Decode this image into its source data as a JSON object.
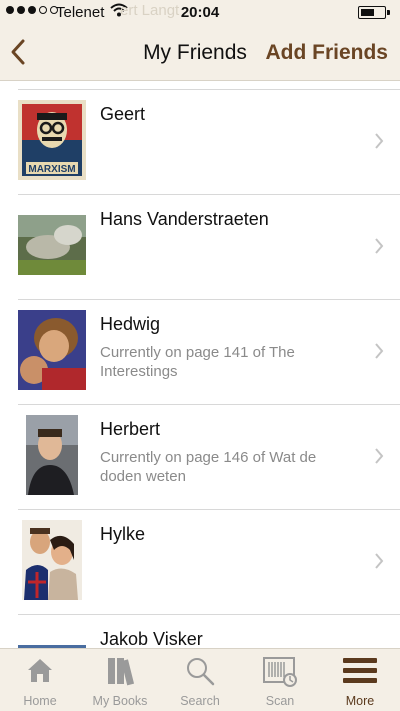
{
  "status_bar": {
    "carrier": "Telenet",
    "time": "20:04"
  },
  "nav": {
    "ghost_title": "ert Langt",
    "title": "My Friends",
    "add_friends": "Add Friends"
  },
  "friends": [
    {
      "name": "Geert",
      "status": "",
      "avatar": "marxism-poster"
    },
    {
      "name": "Hans Vanderstraeten",
      "status": "",
      "avatar": "landscape-photo"
    },
    {
      "name": "Hedwig",
      "status": "Currently on page 141 of The Interestings",
      "avatar": "couple-photo"
    },
    {
      "name": "Herbert",
      "status": "Currently on page 146 of Wat de doden weten",
      "avatar": "portrait-photo"
    },
    {
      "name": "Hylke",
      "status": "",
      "avatar": "couple-photo"
    },
    {
      "name": "Jakob Visker",
      "status": "",
      "avatar": "photo"
    }
  ],
  "tabs": [
    {
      "label": "Home",
      "icon": "home-icon",
      "active": false
    },
    {
      "label": "My Books",
      "icon": "books-icon",
      "active": false
    },
    {
      "label": "Search",
      "icon": "search-icon",
      "active": false
    },
    {
      "label": "Scan",
      "icon": "scan-icon",
      "active": false
    },
    {
      "label": "More",
      "icon": "more-icon",
      "active": true
    }
  ],
  "colors": {
    "bar_background": "#f4efe6",
    "accent_brown": "#6a4524",
    "active_tab": "#5b3a1e",
    "inactive_tab": "#9a9a9a",
    "status_text": "#8a8a8a"
  }
}
